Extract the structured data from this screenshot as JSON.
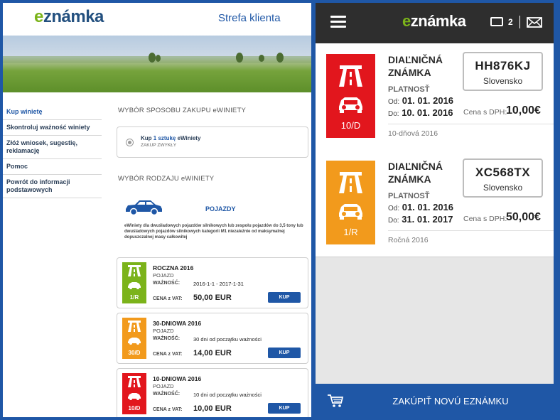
{
  "left": {
    "logo": {
      "e": "e",
      "rest": "známka"
    },
    "portal_title": "Strefa klienta",
    "nav": [
      "Kup winietę",
      "Skontroluj ważność winiety",
      "Złóż wniosek, sugestię, reklamację",
      "Pomoc",
      "Powrót do informacji podstawowych"
    ],
    "purchase_heading": "WYBÓR SPOSOBU ZAKUPU eWINIETY",
    "purchase_option": {
      "pre": "Kup ",
      "bold": "1 sztukę",
      "post": " eWiniety",
      "sub": "ZAKUP ZWYKŁY"
    },
    "type_heading": "WYBÓR RODZAJU eWINIETY",
    "vehicle_label": "POJAZDY",
    "vehicle_desc": "eWiniety dla dwuśladowych pojazdów silnikowych lub zespołu pojazdów do 3,5 tony lub dwuśladowych pojazdów silnikowych kategorii M1 niezależnie od maksymalnej dopuszczalnej masy całkowitej",
    "products": [
      {
        "name": "ROCZNA 2016",
        "type": "POJAZD",
        "validity_label": "WAŻNOŚĆ:",
        "validity": "2016-1-1 - 2017-1-31",
        "price_label": "CENA z VAT:",
        "price": "50,00 EUR",
        "code": "1/R",
        "color": "#7bb31a",
        "buy": "KUP"
      },
      {
        "name": "30-DNIOWA 2016",
        "type": "POJAZD",
        "validity_label": "WAŻNOŚĆ:",
        "validity": "30 dni od początku ważności",
        "price_label": "CENA z VAT:",
        "price": "14,00 EUR",
        "code": "30/D",
        "color": "#f29a1c",
        "buy": "KUP"
      },
      {
        "name": "10-DNIOWA 2016",
        "type": "POJAZD",
        "validity_label": "WAŻNOŚĆ:",
        "validity": "10 dni od początku ważności",
        "price_label": "CENA z VAT:",
        "price": "10,00 EUR",
        "code": "10/D",
        "color": "#e2161d",
        "buy": "KUP"
      }
    ]
  },
  "right": {
    "logo": {
      "e": "e",
      "rest": "známka"
    },
    "vignette_count": "2",
    "cards": [
      {
        "type": "DIAĽNIČNÁ ZNÁMKA",
        "plate": "HH876KJ",
        "country": "Slovensko",
        "validity_label": "PLATNOSŤ",
        "from_label": "Od:",
        "from": "01. 01. 2016",
        "to_label": "Do:",
        "to": "10. 01. 2016",
        "price_label": "Cena s DPH:",
        "price": "10,00€",
        "duration": "10-dňová 2016",
        "code": "10/D",
        "color": "#e2161d"
      },
      {
        "type": "DIAĽNIČNÁ ZNÁMKA",
        "plate": "XC568TX",
        "country": "Slovensko",
        "validity_label": "PLATNOSŤ",
        "from_label": "Od:",
        "from": "01. 01. 2016",
        "to_label": "Do:",
        "to": "31. 01. 2017",
        "price_label": "Cena s DPH:",
        "price": "50,00€",
        "duration": "Ročná 2016",
        "code": "1/R",
        "color": "#f29a1c"
      }
    ],
    "buy_button": "ZAKÚPIŤ NOVÚ EZNÁMKU"
  },
  "colors": {
    "brand_blue": "#1f57a6",
    "green": "#7bb31a",
    "orange": "#f29a1c",
    "red": "#e2161d",
    "header_dark": "#2e2e2e"
  },
  "icons": [
    "highway-icon",
    "car-icon",
    "menu-icon",
    "vignette-icon",
    "mail-icon",
    "cart-icon"
  ]
}
